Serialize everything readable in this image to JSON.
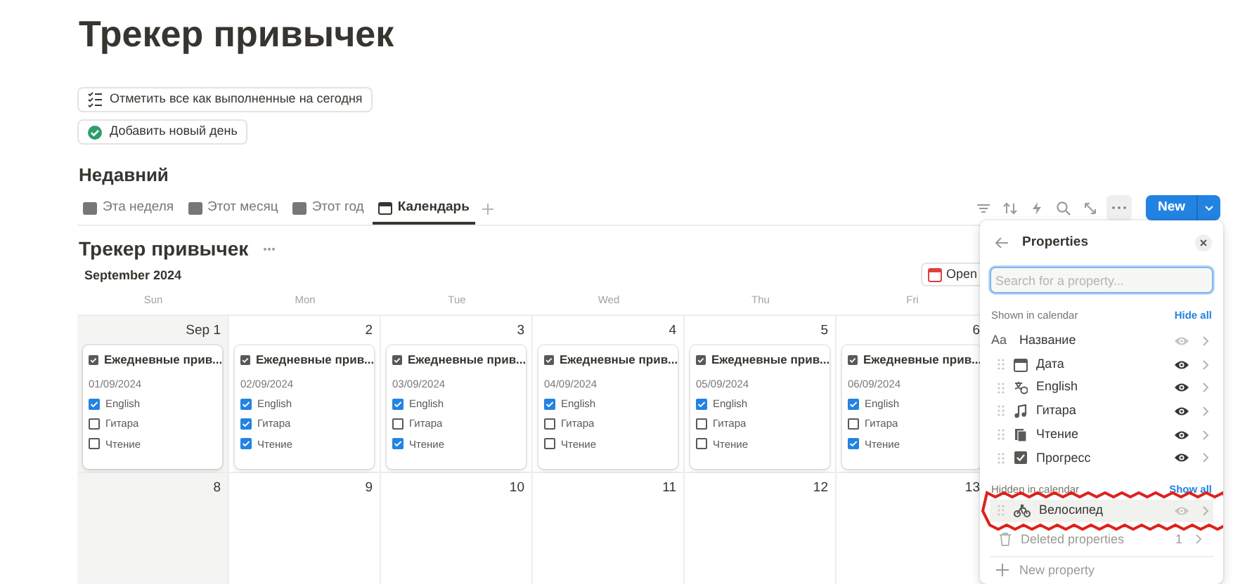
{
  "page_title": "Трекер привычек",
  "buttons": [
    {
      "kind": "checklist",
      "label": "Отметить все как выполненные на сегодня"
    },
    {
      "kind": "check-circle",
      "label": "Добавить новый день"
    }
  ],
  "section_title": "Недавний",
  "tabs": [
    {
      "label": "Эта неделя",
      "selected": false
    },
    {
      "label": "Этот месяц",
      "selected": false
    },
    {
      "label": "Этот год",
      "selected": false
    },
    {
      "label": "Календарь",
      "selected": true
    }
  ],
  "toolbar": {
    "new_button": "New"
  },
  "database_title": "Трекер привычек",
  "calendar": {
    "month": "September 2024",
    "open_button": "Open",
    "weekdays": [
      {
        "label": "Sun",
        "weekend": true
      },
      {
        "label": "Mon",
        "weekend": false
      },
      {
        "label": "Tue",
        "weekend": false
      },
      {
        "label": "Wed",
        "weekend": false
      },
      {
        "label": "Thu",
        "weekend": false
      },
      {
        "label": "Fri",
        "weekend": false
      }
    ],
    "weeks": [
      {
        "days": [
          {
            "number": "Sep 1",
            "card": {
              "title": "Ежедневные прив...",
              "date": "01/09/2024",
              "habits": [
                {
                  "label": "English",
                  "checked": true
                },
                {
                  "label": "Гитара",
                  "checked": false
                },
                {
                  "label": "Чтение",
                  "checked": false
                }
              ]
            }
          },
          {
            "number": "2",
            "card": {
              "title": "Ежедневные прив...",
              "date": "02/09/2024",
              "habits": [
                {
                  "label": "English",
                  "checked": true
                },
                {
                  "label": "Гитара",
                  "checked": true
                },
                {
                  "label": "Чтение",
                  "checked": true
                }
              ]
            }
          },
          {
            "number": "3",
            "card": {
              "title": "Ежедневные прив...",
              "date": "03/09/2024",
              "habits": [
                {
                  "label": "English",
                  "checked": true
                },
                {
                  "label": "Гитара",
                  "checked": false
                },
                {
                  "label": "Чтение",
                  "checked": true
                }
              ]
            }
          },
          {
            "number": "4",
            "card": {
              "title": "Ежедневные прив...",
              "date": "04/09/2024",
              "habits": [
                {
                  "label": "English",
                  "checked": true
                },
                {
                  "label": "Гитара",
                  "checked": false
                },
                {
                  "label": "Чтение",
                  "checked": false
                }
              ]
            }
          },
          {
            "number": "5",
            "card": {
              "title": "Ежедневные прив...",
              "date": "05/09/2024",
              "habits": [
                {
                  "label": "English",
                  "checked": true
                },
                {
                  "label": "Гитара",
                  "checked": false
                },
                {
                  "label": "Чтение",
                  "checked": false
                }
              ]
            }
          },
          {
            "number": "6",
            "card": {
              "title": "Ежедневные прив...",
              "date": "06/09/2024",
              "habits": [
                {
                  "label": "English",
                  "checked": true
                },
                {
                  "label": "Гитара",
                  "checked": false
                },
                {
                  "label": "Чтение",
                  "checked": true
                }
              ]
            }
          }
        ]
      },
      {
        "days": [
          {
            "number": "8"
          },
          {
            "number": "9"
          },
          {
            "number": "10"
          },
          {
            "number": "11"
          },
          {
            "number": "12"
          },
          {
            "number": "13"
          }
        ]
      }
    ]
  },
  "properties_panel": {
    "title": "Properties",
    "search_placeholder": "Search for a property...",
    "shown_label": "Shown in calendar",
    "hide_all": "Hide all",
    "shown": [
      {
        "kind": "title",
        "type_label": "Aa",
        "name": "Название",
        "visible": true,
        "locked": true,
        "highlighted": false
      },
      {
        "kind": "date",
        "name": "Дата",
        "visible": true,
        "locked": false,
        "highlighted": false
      },
      {
        "kind": "language",
        "name": "English",
        "visible": true,
        "locked": false,
        "highlighted": false
      },
      {
        "kind": "music",
        "name": "Гитара",
        "visible": true,
        "locked": false,
        "highlighted": false
      },
      {
        "kind": "book",
        "name": "Чтение",
        "visible": true,
        "locked": false,
        "highlighted": false
      },
      {
        "kind": "checkbox",
        "name": "Прогресс",
        "visible": true,
        "locked": false,
        "highlighted": false
      }
    ],
    "hidden_label": "Hidden in calendar",
    "show_all": "Show all",
    "hidden": [
      {
        "kind": "bike",
        "name": "Велосипед",
        "visible": false,
        "locked": false,
        "highlighted": true
      }
    ],
    "deleted_label": "Deleted properties",
    "deleted_count": "1",
    "new_property": "New property"
  }
}
